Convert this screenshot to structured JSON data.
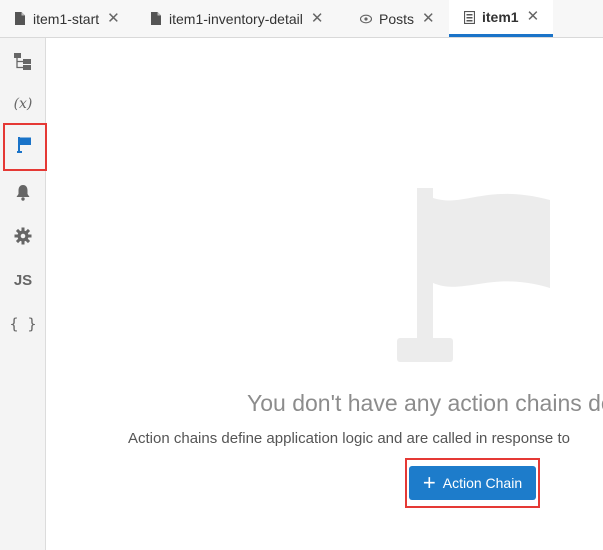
{
  "tabs": [
    {
      "label": "item1-start",
      "icon": "page-icon",
      "active": false
    },
    {
      "label": "item1-inventory-detail",
      "icon": "page-icon",
      "active": false
    },
    {
      "label": "Posts",
      "icon": "eye-icon",
      "active": false
    },
    {
      "label": "item1",
      "icon": "flow-icon",
      "active": true
    }
  ],
  "tab_close_glyph": "✕",
  "sidebar": {
    "items": [
      {
        "name": "structure-icon"
      },
      {
        "name": "variables-icon",
        "text": "(x)"
      },
      {
        "name": "flag-icon",
        "selected": true
      },
      {
        "name": "bell-icon"
      },
      {
        "name": "gear-icon"
      },
      {
        "name": "js-icon",
        "text": "JS"
      },
      {
        "name": "json-braces-icon",
        "text": "{ }"
      }
    ]
  },
  "empty_state": {
    "title": "You don't have any action chains de",
    "description": "Action chains define application logic and are called in response to",
    "button_label": "Action Chain",
    "button_icon": "+"
  },
  "colors": {
    "accent": "#1d7ccb",
    "highlight": "#e53935",
    "flag_gray": "#ececec"
  }
}
